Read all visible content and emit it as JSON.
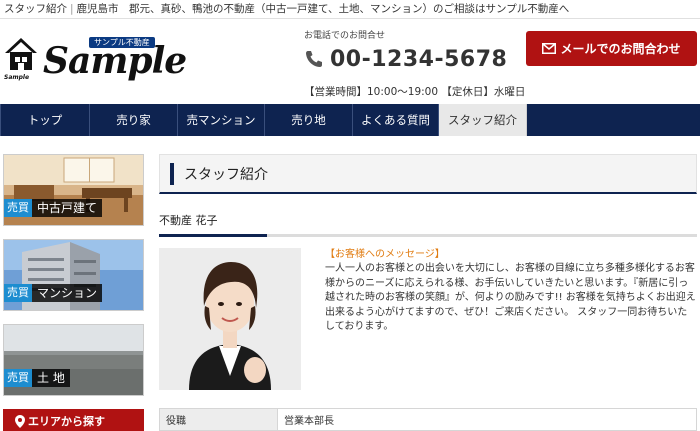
{
  "topbar": {
    "page_name": "スタッフ紹介",
    "separator": "|",
    "lead": "鹿児島市　郡元、真砂、鴨池の不動産（中古一戸建て、土地、マンション）のご相談はサンプル不動産へ"
  },
  "logo": {
    "tagline": "サンプル不動産",
    "name": "Sample",
    "small": "Sample"
  },
  "contact": {
    "caption": "お電話でのお問合せ",
    "phone": "00-1234-5678",
    "hours": "【営業時間】10:00～19:00 【定休日】水曜日",
    "mail_button": "メールでのお問合わせ"
  },
  "nav": {
    "items": [
      {
        "label": "トップ"
      },
      {
        "label": "売り家"
      },
      {
        "label": "売マンション"
      },
      {
        "label": "売り地"
      },
      {
        "label": "よくある質問"
      },
      {
        "label": "スタッフ紹介"
      }
    ]
  },
  "sidebar": {
    "banners": [
      {
        "tag": "売買",
        "label": "中古戸建て"
      },
      {
        "tag": "売買",
        "label": "マンション"
      },
      {
        "tag": "売買",
        "label": "土 地"
      }
    ],
    "area_button": "エリアから探す"
  },
  "main": {
    "heading": "スタッフ紹介",
    "staff_name": "不動産 花子",
    "message_heading": "【お客様へのメッセージ】",
    "message_body": "一人一人のお客様との出会いを大切にし、お客様の目線に立ち多種多様化するお客様からのニーズに応えられる様、お手伝いしていきたいと思います。『新居に引っ越された時のお客様の笑顔』が、何よりの励みです!! お客様を気持ちよくお出迎え出来るよう心がけてますので、ぜひ！ご来店ください。 スタッフ一同お待ちいたしております。",
    "table": [
      {
        "label": "役職",
        "value": "営業本部長"
      }
    ]
  },
  "colors": {
    "nav_bg": "#0e2350",
    "brand_red": "#b01212",
    "accent_blue": "#1d8dd0",
    "message_orange": "#e07b10"
  }
}
